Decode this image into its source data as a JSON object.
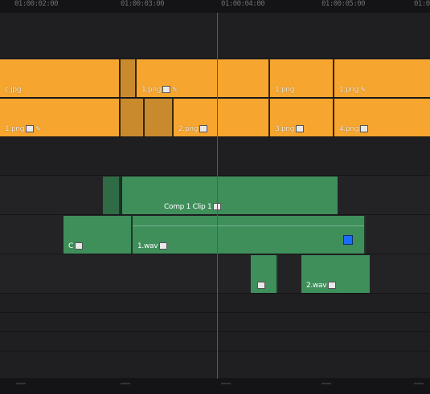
{
  "ruler": {
    "ticks": [
      "01:00:02:00",
      "01:00:03:00",
      "01:00:04:00",
      "01:00:05:00",
      "01:00"
    ]
  },
  "video": {
    "track1": [
      {
        "name": "c.jpg"
      },
      {
        "name": "1.png"
      },
      {
        "name": "1.png"
      },
      {
        "name": "1.png"
      }
    ],
    "track2": [
      {
        "name": "1.png"
      },
      {
        "name": "2.png"
      },
      {
        "name": "3.png"
      },
      {
        "name": "4.png"
      }
    ]
  },
  "audio": {
    "a1_label": "Comp 1 Clip 1",
    "a2_left_label": "C",
    "a2_right_label": "1.wav",
    "a3_left_label": "",
    "a3_right_label": "2.wav"
  },
  "colors": {
    "video_clip": "#f6a52e",
    "audio_clip": "#3f8f5b",
    "marker": "#1a6cff"
  }
}
